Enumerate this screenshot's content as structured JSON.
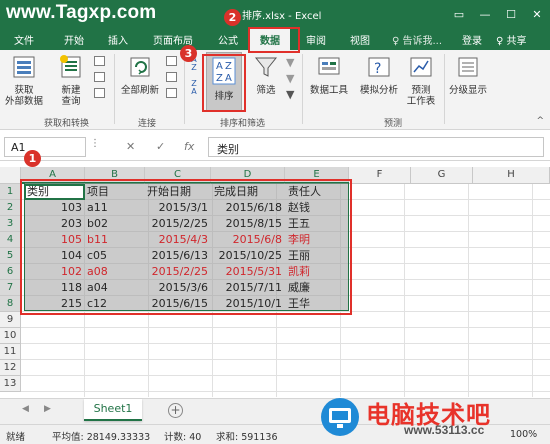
{
  "watermark_site": "www.Tagxp.com",
  "window": {
    "title": "排序.xlsx - Excel",
    "min": "—",
    "max": "☐",
    "close": "✕"
  },
  "tabs": [
    "文件",
    "开始",
    "插入",
    "页面布局",
    "公式",
    "数据",
    "审阅",
    "视图"
  ],
  "active_tab": "数据",
  "tell_me": "♀ 告诉我...",
  "login": "登录",
  "share": "♀ 共享",
  "ribbon": {
    "get_external_data": "获取\n外部数据",
    "new_query": "新建\n查询",
    "refresh_all": "全部刷新",
    "sort": "排序",
    "filter": "筛选",
    "data_tools": "数据工具",
    "what_if": "模拟分析",
    "forecast_sheet": "预测\n工作表",
    "outline": "分级显示",
    "group_get_transform": "获取和转换",
    "group_connections": "连接",
    "group_sort_filter": "排序和筛选",
    "group_forecast": "预测",
    "az_top": "A Z",
    "az_bottom": "Z A"
  },
  "formula_bar": {
    "name_box": "A1",
    "cancel": "✕",
    "enter": "✓",
    "fx": "fx",
    "content": "类别"
  },
  "columns": [
    "A",
    "B",
    "C",
    "D",
    "E",
    "F",
    "G",
    "H"
  ],
  "rows": [
    "1",
    "2",
    "3",
    "4",
    "5",
    "6",
    "7",
    "8",
    "9",
    "10",
    "11",
    "12",
    "13"
  ],
  "table": {
    "headers": [
      "类别",
      "项目",
      "开始日期",
      "完成日期",
      "责任人"
    ],
    "rows": [
      {
        "a": "103",
        "b": "a11",
        "c": "2015/3/1",
        "d": "2015/6/18",
        "e": "赵钱",
        "red": false
      },
      {
        "a": "203",
        "b": "b02",
        "c": "2015/2/25",
        "d": "2015/8/15",
        "e": "王五",
        "red": false
      },
      {
        "a": "105",
        "b": "b11",
        "c": "2015/4/3",
        "d": "2015/6/8",
        "e": "李明",
        "red": true
      },
      {
        "a": "104",
        "b": "c05",
        "c": "2015/6/13",
        "d": "2015/10/25",
        "e": "王丽",
        "red": false
      },
      {
        "a": "102",
        "b": "a08",
        "c": "2015/2/25",
        "d": "2015/5/31",
        "e": "凯莉",
        "red": true
      },
      {
        "a": "118",
        "b": "a04",
        "c": "2015/3/6",
        "d": "2015/7/11",
        "e": "威廉",
        "red": false
      },
      {
        "a": "215",
        "b": "c12",
        "c": "2015/6/15",
        "d": "2015/10/1",
        "e": "王华",
        "red": false
      }
    ]
  },
  "badges": [
    "1",
    "2",
    "3"
  ],
  "sheet_tab": "Sheet1",
  "add_sheet": "+",
  "status": {
    "ready": "就绪",
    "average": "平均值: 28149.33333",
    "count": "计数: 40",
    "sum": "求和: 591136",
    "zoom": "100%"
  },
  "brand_watermark": {
    "text": "电脑技术吧",
    "url": "www.53113.cc"
  },
  "colors": {
    "excel_green": "#217346",
    "highlight_red": "#e0302a",
    "red_text": "#d0262c"
  }
}
